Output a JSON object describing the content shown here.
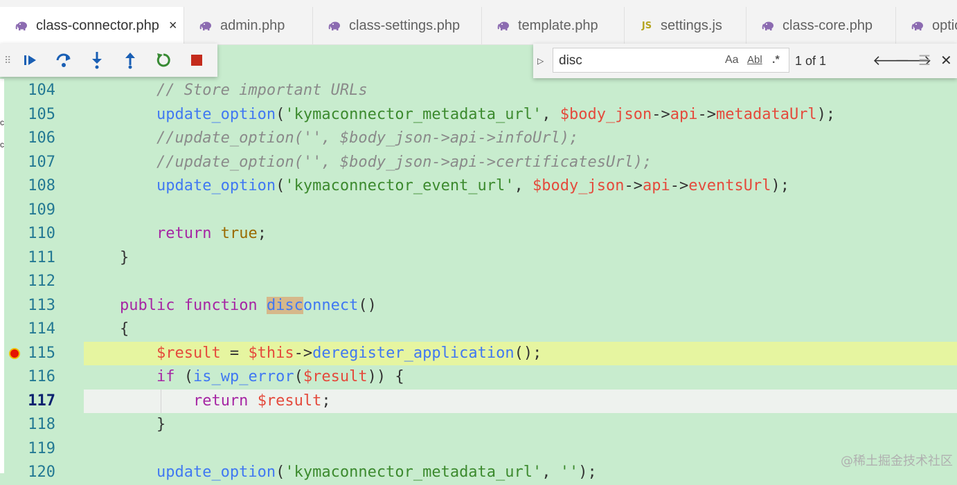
{
  "tabs": [
    {
      "label": "class-connector.php",
      "icon": "php-elephant-icon",
      "active": true,
      "close": "×"
    },
    {
      "label": "admin.php",
      "icon": "php-elephant-icon"
    },
    {
      "label": "class-settings.php",
      "icon": "php-elephant-icon"
    },
    {
      "label": "template.php",
      "icon": "php-elephant-icon"
    },
    {
      "label": "settings.js",
      "icon": "js-file-icon",
      "icon_text": "JS"
    },
    {
      "label": "class-core.php",
      "icon": "php-elephant-icon"
    },
    {
      "label": "optio",
      "icon": "php-elephant-icon"
    }
  ],
  "debug_toolbar": {
    "buttons": [
      "continue",
      "step-over",
      "step-into",
      "step-out",
      "restart",
      "stop"
    ],
    "colors": {
      "blue": "#1a5fb4",
      "green": "#388a34",
      "red": "#c42b1c"
    }
  },
  "find": {
    "query": "disc",
    "match_case": "Aa",
    "whole_word": "Abl",
    "regex": ".*",
    "count": "1 of 1"
  },
  "editor": {
    "left_strip_chars": [
      "c",
      "c"
    ],
    "lines": [
      {
        "n": "104"
      },
      {
        "n": "105"
      },
      {
        "n": "106"
      },
      {
        "n": "107"
      },
      {
        "n": "108"
      },
      {
        "n": "109"
      },
      {
        "n": "110"
      },
      {
        "n": "111"
      },
      {
        "n": "112"
      },
      {
        "n": "113"
      },
      {
        "n": "114"
      },
      {
        "n": "115"
      },
      {
        "n": "116"
      },
      {
        "n": "117"
      },
      {
        "n": "118"
      },
      {
        "n": "119"
      },
      {
        "n": "120"
      }
    ],
    "code": {
      "l104": "// Store important URLs",
      "l105": [
        "update_option",
        "(",
        "'kymaconnector_metadata_url'",
        ", ",
        "$body_json",
        "->",
        "api",
        "->",
        "metadataUrl",
        ");"
      ],
      "l106": "//update_option('', $body_json->api->infoUrl);",
      "l107": "//update_option('', $body_json->api->certificatesUrl);",
      "l108": [
        "update_option",
        "(",
        "'kymaconnector_event_url'",
        ", ",
        "$body_json",
        "->",
        "api",
        "->",
        "eventsUrl",
        ");"
      ],
      "l110": [
        "return",
        " ",
        "true",
        ";"
      ],
      "l111": "}",
      "l113": [
        "public",
        " ",
        "function",
        " ",
        "disc",
        "onnect",
        "()"
      ],
      "l114": "{",
      "l115": [
        "$result",
        " = ",
        "$this",
        "->",
        "deregister_application",
        "();"
      ],
      "l116": [
        "if",
        " (",
        "is_wp_error",
        "(",
        "$result",
        ")) {"
      ],
      "l117": [
        "return",
        " ",
        "$result",
        ";"
      ],
      "l118": "}",
      "l120": [
        "update_option",
        "(",
        "'kymaconnector_metadata_url'",
        ", ",
        "''",
        ");"
      ]
    },
    "breakpoint_line": "115",
    "current_line": "117"
  },
  "watermark": "@稀土掘金技术社区"
}
